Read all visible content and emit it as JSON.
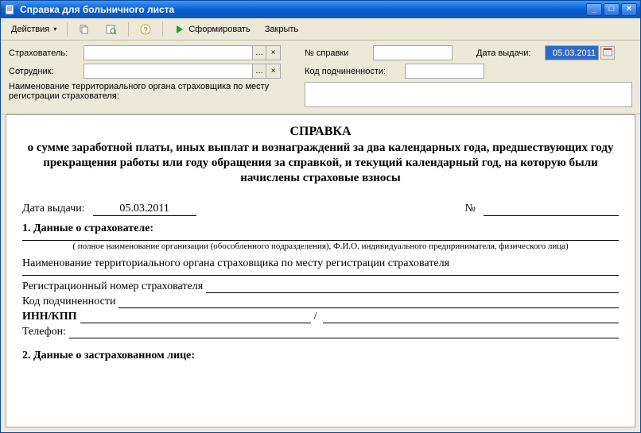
{
  "window": {
    "title": "Справка для больничного листа"
  },
  "toolbar": {
    "actions": "Действия",
    "generate": "Сформировать",
    "close": "Закрыть"
  },
  "form": {
    "insurer_label": "Страхователь:",
    "employee_label": "Сотрудник:",
    "ref_no_label": "№ справки",
    "sub_code_label": "Код подчиненности:",
    "issue_date_label": "Дата выдачи:",
    "issue_date_value": "05.03.2011",
    "territorial_label": "Наименование территориального органа страховщика по месту регистрации страхователя:",
    "insurer_value": "",
    "employee_value": "",
    "ref_no_value": "",
    "sub_code_value": "",
    "territorial_value": ""
  },
  "document": {
    "title": "СПРАВКА",
    "subtitle": "о сумме заработной платы, иных выплат и вознаграждений за два календарных года, предшествующих году прекращения работы или году обращения за справкой, и текущий календарный год, на которую были начислены страховые взносы",
    "issue_date_label": "Дата выдачи:",
    "issue_date_value": "05.03.2011",
    "number_label": "№",
    "section1_title": "1. Данные о страхователе:",
    "hint1": "( полное наименование организации (обособленного подразделения), Ф.И.О.  индивидуального предпринимателя, физического лица)",
    "territorial_text": "Наименование территориального органа страховщика по месту регистрации страхователя",
    "reg_no_label": "Регистрационный номер страхователя",
    "sub_code_label": "Код подчиненности",
    "inn_kpp_label": "ИНН/КПП",
    "inn_kpp_sep": "/",
    "phone_label": "Телефон:",
    "section2_title": "2. Данные о застрахованном лице:"
  }
}
